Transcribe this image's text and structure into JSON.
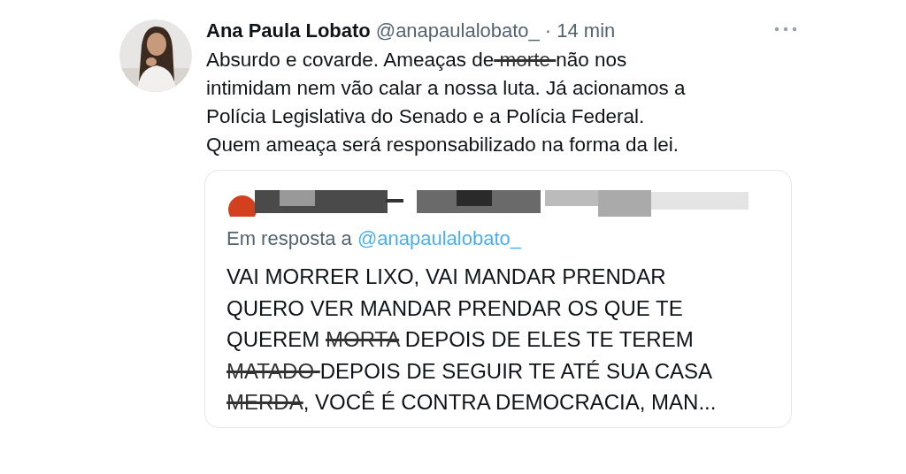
{
  "tweet": {
    "author": "Ana Paula Lobato",
    "handle": "@anapaulalobato_",
    "time": "· 14 min",
    "avatar": {
      "kind": "picture"
    },
    "body": [
      [
        {
          "text": "Absurdo e covarde. Ameaças de",
          "struck": false
        },
        {
          "text": " morte ",
          "struck": true
        },
        {
          "text": "não nos",
          "struck": false
        }
      ],
      [
        {
          "text": "intimidam nem vão calar a nossa luta. Já acionamos a",
          "struck": false
        }
      ],
      [
        {
          "text": "Polícia Legislativa do Senado e a Polícia Federal.",
          "struck": false
        }
      ],
      [
        {
          "text": "Quem ameaça será responsabilizado na forma da lei.",
          "struck": false
        }
      ]
    ],
    "quote": {
      "reply_prefix": "Em resposta a",
      "reply_handle": "@anapaulalobato_",
      "body": [
        [
          {
            "text": "VAI MORRER LIXO, VAI MANDAR PRENDAR",
            "struck": false
          }
        ],
        [
          {
            "text": "QUERO VER MANDAR PRENDAR OS QUE TE",
            "struck": false
          }
        ],
        [
          {
            "text": "QUEREM ",
            "struck": false
          },
          {
            "text": "MORTA",
            "struck": true
          },
          {
            "text": " DEPOIS DE ELES TE TEREM",
            "struck": false
          }
        ],
        [
          {
            "text": "MATADO ",
            "struck": true
          },
          {
            "text": "DEPOIS DE SEGUIR TE ATÉ SUA CASA",
            "struck": false
          }
        ],
        [
          {
            "text": "MERDA",
            "struck": true
          },
          {
            "text": ", VOCÊ É CONTRA DEMOCRACIA, MAN...",
            "struck": false
          }
        ]
      ]
    }
  }
}
